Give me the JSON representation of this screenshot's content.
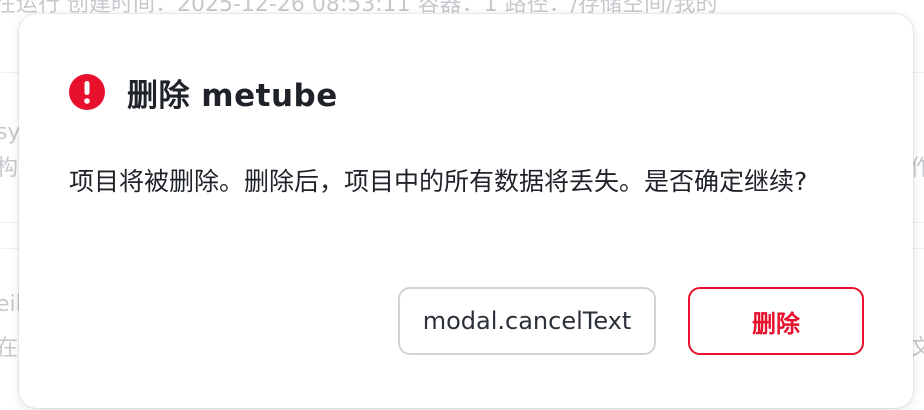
{
  "background": {
    "row1_text": "在运行    创建时间：2025-12-26 08:53:11    容器：1    路径：/存储空间/我的",
    "row2_left": "sy",
    "row2_left_sub": "构",
    "row2_right": "作",
    "row3_left": "eil",
    "row3_left_sub": "在",
    "row3_right": "文"
  },
  "modal": {
    "title": "删除 metube",
    "icon": "exclamation-circle-icon",
    "message": "项目将被删除。删除后，项目中的所有数据将丢失。是否确定继续?",
    "cancel_label": "modal.cancelText",
    "delete_label": "删除"
  },
  "colors": {
    "danger": "#e8112d",
    "text": "#1f2329",
    "border": "#cfd4da"
  }
}
